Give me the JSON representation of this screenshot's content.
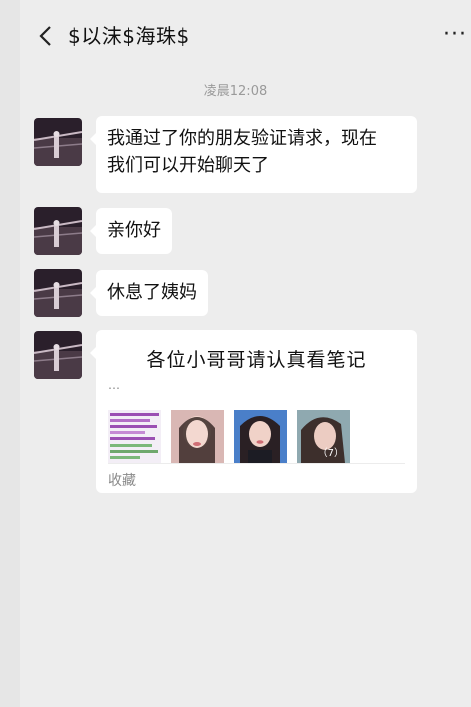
{
  "header": {
    "title": "$以沫$海珠$",
    "more_label": "···"
  },
  "chat": {
    "timestamp": "凌晨12:08",
    "messages": [
      {
        "text_line1": "我通过了你的朋友验证请求，现在",
        "text_line2": "我们可以开始聊天了"
      },
      {
        "text": "亲你好"
      },
      {
        "text": "休息了姨妈"
      }
    ],
    "card": {
      "title": "各位小哥哥请认真看笔记",
      "ellipsis": "…",
      "image_count": "（7）",
      "footer": "收藏"
    }
  },
  "colors": {
    "background": "#ededed",
    "bubble": "#ffffff",
    "timestamp": "#9a9a9a"
  }
}
